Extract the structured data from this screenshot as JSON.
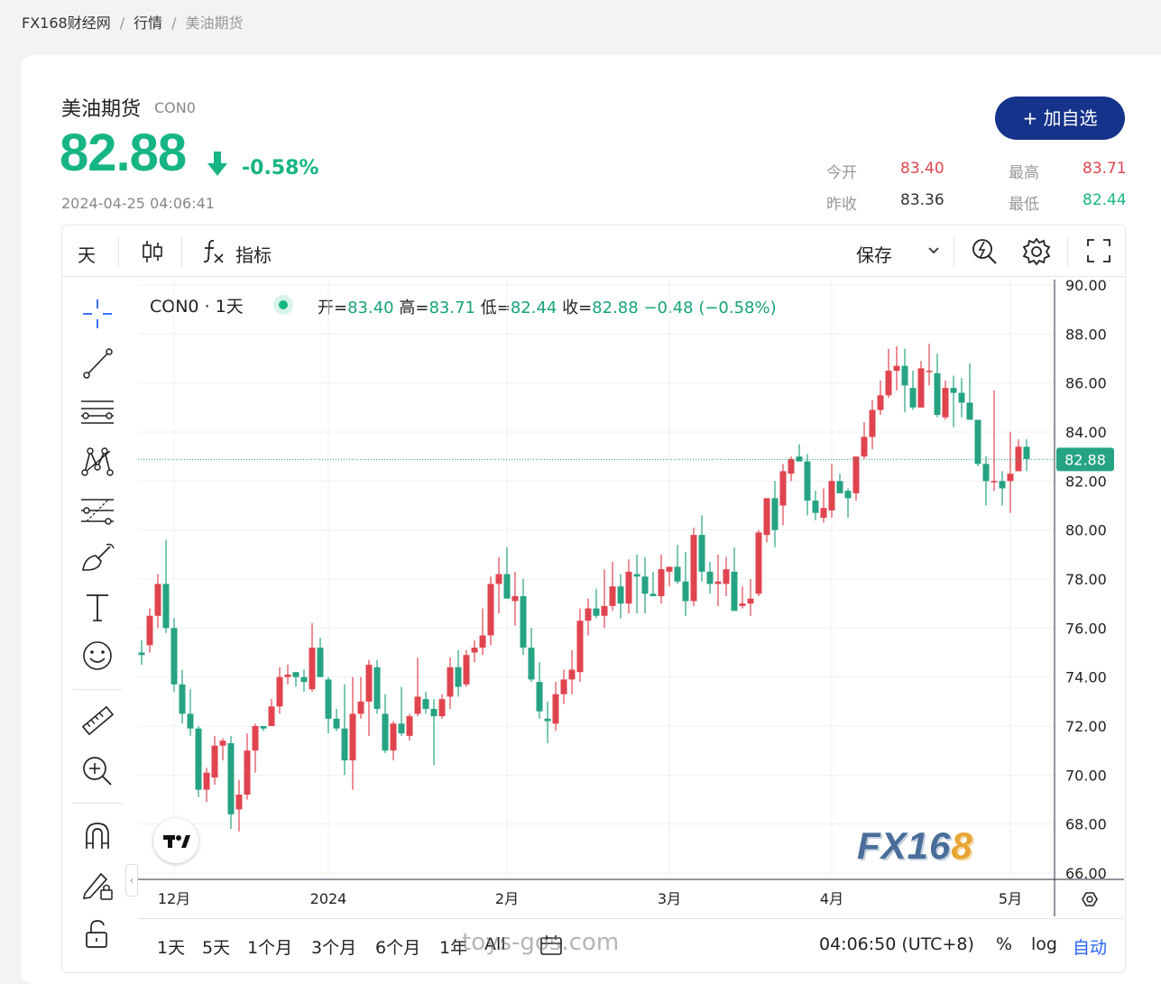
{
  "breadcrumb": [
    "FX168财经网",
    "行情",
    "美油期货"
  ],
  "instrument": {
    "name": "美油期货",
    "code": "CON0",
    "price": "82.88",
    "change_pct": "-0.58%",
    "timestamp": "2024-04-25 04:06:41"
  },
  "add_button": "+ 加自选",
  "stats": {
    "open_label": "今开",
    "open": "83.40",
    "high_label": "最高",
    "high": "83.71",
    "prev_label": "昨收",
    "prev": "83.36",
    "low_label": "最低",
    "low": "82.44"
  },
  "toolbar": {
    "interval": "天",
    "indicators": "指标",
    "save": "保存"
  },
  "legend": {
    "symbol": "CON0 · 1天",
    "o_label": "开=",
    "o": "83.40",
    "h_label": "高=",
    "h": "83.71",
    "l_label": "低=",
    "l": "82.44",
    "c_label": "收=",
    "c": "82.88",
    "change": "−0.48 (−0.58%)"
  },
  "bottom": {
    "ranges": [
      "1天",
      "5天",
      "1个月",
      "3个月",
      "6个月",
      "1年",
      "All"
    ],
    "clock": "04:06:50 (UTC+8)",
    "pct": "%",
    "log": "log",
    "auto": "自动"
  },
  "watermark": "toys-gos.com",
  "logo": {
    "fx": "FX16",
    "eight": "8"
  },
  "colors": {
    "up": "#e0444f",
    "down": "#26a383",
    "accent": "#15338a"
  },
  "chart_data": {
    "type": "candlestick",
    "symbol": "CON0",
    "y_ticks": [
      "66.00",
      "68.00",
      "70.00",
      "72.00",
      "74.00",
      "76.00",
      "78.00",
      "80.00",
      "82.00",
      "84.00",
      "86.00",
      "88.00",
      "90.00"
    ],
    "ylim": [
      66,
      90
    ],
    "x_ticks": [
      "12月",
      "2024",
      "2月",
      "3月",
      "4月",
      "5月"
    ],
    "x_tick_index": [
      4,
      23,
      45,
      65,
      85,
      107
    ],
    "last_price": "82.88",
    "candles": [
      [
        75.0,
        75.5,
        74.5,
        74.9
      ],
      [
        75.3,
        76.8,
        75.0,
        76.5
      ],
      [
        76.5,
        78.2,
        76.0,
        77.8
      ],
      [
        77.8,
        79.6,
        75.8,
        76.0
      ],
      [
        76.0,
        76.4,
        73.4,
        73.7
      ],
      [
        73.7,
        74.3,
        72.1,
        72.5
      ],
      [
        72.5,
        73.5,
        71.6,
        71.9
      ],
      [
        71.9,
        72.0,
        69.1,
        69.4
      ],
      [
        69.4,
        70.3,
        68.9,
        70.1
      ],
      [
        69.9,
        71.6,
        69.6,
        71.2
      ],
      [
        71.2,
        71.5,
        70.6,
        71.4
      ],
      [
        71.3,
        71.6,
        67.8,
        68.4
      ],
      [
        68.6,
        69.8,
        67.7,
        69.2
      ],
      [
        69.2,
        71.7,
        69.0,
        71.0
      ],
      [
        71.0,
        72.1,
        70.1,
        72.0
      ],
      [
        72.0,
        72.0,
        71.8,
        71.9
      ],
      [
        72.0,
        73.1,
        72.0,
        72.8
      ],
      [
        72.8,
        74.4,
        72.5,
        74.0
      ],
      [
        74.0,
        74.5,
        73.7,
        74.1
      ],
      [
        74.2,
        74.2,
        73.6,
        74.0
      ],
      [
        74.0,
        74.3,
        73.4,
        73.8
      ],
      [
        73.5,
        76.2,
        73.4,
        75.2
      ],
      [
        75.2,
        75.6,
        74.0,
        74.0
      ],
      [
        73.9,
        74.0,
        71.7,
        72.3
      ],
      [
        72.3,
        72.7,
        71.8,
        71.9
      ],
      [
        71.9,
        73.7,
        70.0,
        70.6
      ],
      [
        70.6,
        74.0,
        69.4,
        72.5
      ],
      [
        72.5,
        74.0,
        72.3,
        73.0
      ],
      [
        73.0,
        74.7,
        71.6,
        74.5
      ],
      [
        74.4,
        74.7,
        72.5,
        72.7
      ],
      [
        72.5,
        73.3,
        70.9,
        71.0
      ],
      [
        71.0,
        72.2,
        70.6,
        72.1
      ],
      [
        72.1,
        73.6,
        71.6,
        71.7
      ],
      [
        71.6,
        72.5,
        71.4,
        72.4
      ],
      [
        72.5,
        74.8,
        72.4,
        73.2
      ],
      [
        73.1,
        73.4,
        72.5,
        72.7
      ],
      [
        72.7,
        73.1,
        70.4,
        72.4
      ],
      [
        72.4,
        73.3,
        72.3,
        73.1
      ],
      [
        73.2,
        74.8,
        72.7,
        74.4
      ],
      [
        74.4,
        75.1,
        73.2,
        73.6
      ],
      [
        73.7,
        75.1,
        73.6,
        74.9
      ],
      [
        75.0,
        75.5,
        74.6,
        75.2
      ],
      [
        75.2,
        76.8,
        74.9,
        75.7
      ],
      [
        75.7,
        78.1,
        75.3,
        77.8
      ],
      [
        77.8,
        78.9,
        76.6,
        78.2
      ],
      [
        78.2,
        79.3,
        77.4,
        77.2
      ],
      [
        77.1,
        78.3,
        76.1,
        77.3
      ],
      [
        77.3,
        78.0,
        74.9,
        75.2
      ],
      [
        75.2,
        76.0,
        73.8,
        73.9
      ],
      [
        73.8,
        74.6,
        72.3,
        72.6
      ],
      [
        72.3,
        73.0,
        71.3,
        72.2
      ],
      [
        72.1,
        73.8,
        71.8,
        73.3
      ],
      [
        73.3,
        74.3,
        72.9,
        73.9
      ],
      [
        73.9,
        75.1,
        73.3,
        74.3
      ],
      [
        74.2,
        76.8,
        73.8,
        76.3
      ],
      [
        76.3,
        77.2,
        75.7,
        76.8
      ],
      [
        76.8,
        77.6,
        76.4,
        76.5
      ],
      [
        76.5,
        78.4,
        76.0,
        76.9
      ],
      [
        76.9,
        78.7,
        76.7,
        77.7
      ],
      [
        77.7,
        78.2,
        76.4,
        77.0
      ],
      [
        77.0,
        78.8,
        76.6,
        78.3
      ],
      [
        78.2,
        79.0,
        76.6,
        78.1
      ],
      [
        78.1,
        78.9,
        76.6,
        77.4
      ],
      [
        77.4,
        78.3,
        77.3,
        77.3
      ],
      [
        77.3,
        79.0,
        77.0,
        78.4
      ],
      [
        78.3,
        78.5,
        77.7,
        78.5
      ],
      [
        78.5,
        79.4,
        77.8,
        77.9
      ],
      [
        77.9,
        79.1,
        76.5,
        77.1
      ],
      [
        77.1,
        80.1,
        76.9,
        79.8
      ],
      [
        79.8,
        80.6,
        77.9,
        78.3
      ],
      [
        78.3,
        78.7,
        77.4,
        77.8
      ],
      [
        77.8,
        79.0,
        76.9,
        77.9
      ],
      [
        77.8,
        78.9,
        77.3,
        78.4
      ],
      [
        78.3,
        79.3,
        76.7,
        76.7
      ],
      [
        76.9,
        77.7,
        76.8,
        77.0
      ],
      [
        77.0,
        78.0,
        76.5,
        77.2
      ],
      [
        77.4,
        80.0,
        77.3,
        79.9
      ],
      [
        79.8,
        81.2,
        79.5,
        81.3
      ],
      [
        81.3,
        82.0,
        79.3,
        80.0
      ],
      [
        81.0,
        82.7,
        80.2,
        82.4
      ],
      [
        82.3,
        83.0,
        82.0,
        82.9
      ],
      [
        83.0,
        83.5,
        82.8,
        82.8
      ],
      [
        82.8,
        83.1,
        80.6,
        81.2
      ],
      [
        81.2,
        81.6,
        80.4,
        80.7
      ],
      [
        80.5,
        81.7,
        80.3,
        80.9
      ],
      [
        80.8,
        82.7,
        80.5,
        82.0
      ],
      [
        82.0,
        82.3,
        81.7,
        81.5
      ],
      [
        81.6,
        81.7,
        80.5,
        81.3
      ],
      [
        81.5,
        82.9,
        81.2,
        83.0
      ],
      [
        83.0,
        84.4,
        82.9,
        83.8
      ],
      [
        83.8,
        85.3,
        83.3,
        84.9
      ],
      [
        84.9,
        86.1,
        84.7,
        85.5
      ],
      [
        85.5,
        87.4,
        85.4,
        86.5
      ],
      [
        86.5,
        87.5,
        85.7,
        86.7
      ],
      [
        86.7,
        87.4,
        84.8,
        85.9
      ],
      [
        85.8,
        86.5,
        84.9,
        85.0
      ],
      [
        85.0,
        86.9,
        85.0,
        86.6
      ],
      [
        86.5,
        87.6,
        85.9,
        86.5
      ],
      [
        86.4,
        87.2,
        84.6,
        84.7
      ],
      [
        84.6,
        86.1,
        84.5,
        85.8
      ],
      [
        85.8,
        86.3,
        84.2,
        85.6
      ],
      [
        85.6,
        86.2,
        84.6,
        85.2
      ],
      [
        85.2,
        86.8,
        85.0,
        84.5
      ],
      [
        84.5,
        84.4,
        82.6,
        82.7
      ],
      [
        82.7,
        83.0,
        81.0,
        82.0
      ],
      [
        82.0,
        85.7,
        81.6,
        82.0
      ],
      [
        82.0,
        82.4,
        81.0,
        81.7
      ],
      [
        82.0,
        84.0,
        80.7,
        82.3
      ],
      [
        82.4,
        83.7,
        82.4,
        83.4
      ],
      [
        83.4,
        83.7,
        82.4,
        82.9
      ]
    ]
  }
}
